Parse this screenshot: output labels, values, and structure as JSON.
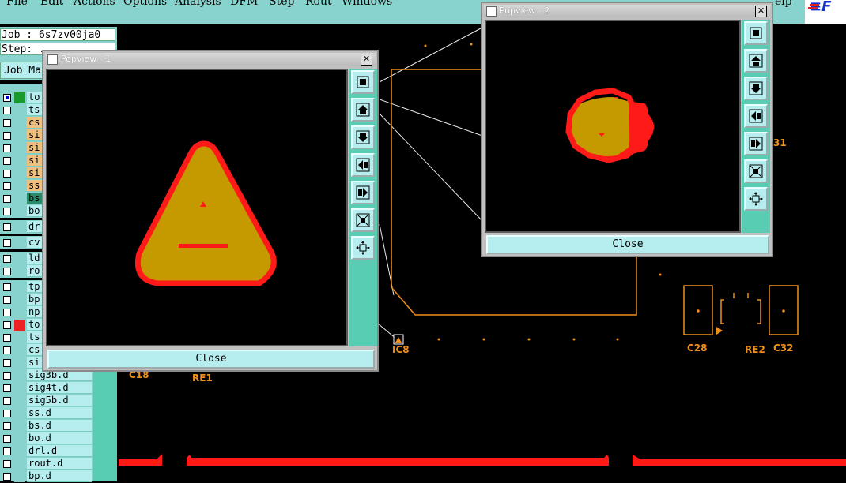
{
  "menu": [
    "File",
    "Edit",
    "Actions",
    "Options",
    "Analysis",
    "DFM",
    "Step",
    "Rout",
    "Windows",
    "elp"
  ],
  "job": {
    "label": "Job : 6s7zv00ja0",
    "step": "Step: ...",
    "job_matrix": "Job Ma"
  },
  "layers": [
    {
      "name": "to",
      "color": "#1a9a2a",
      "check_color": "#0000cc"
    },
    {
      "name": "ts",
      "color": "#89d3cf"
    },
    {
      "name": "cs",
      "color": "#89d3cf",
      "name_bg": "#f0c080"
    },
    {
      "name": "si",
      "color": "#89d3cf",
      "name_bg": "#f0c080"
    },
    {
      "name": "si",
      "color": "#89d3cf",
      "name_bg": "#f0c080"
    },
    {
      "name": "si",
      "color": "#89d3cf",
      "name_bg": "#f0c080"
    },
    {
      "name": "si",
      "color": "#89d3cf",
      "name_bg": "#f0c080"
    },
    {
      "name": "ss",
      "color": "#89d3cf",
      "name_bg": "#f0c080"
    },
    {
      "name": "bs",
      "color": "#89d3cf",
      "name_bg": "#2a8a6a"
    },
    {
      "name": "bo",
      "color": "#89d3cf"
    },
    {
      "name": "dr",
      "color": "#89d3cf"
    },
    {
      "name": "cv",
      "color": "#89d3cf"
    },
    {
      "name": "ld",
      "color": "#89d3cf"
    },
    {
      "name": "ro",
      "color": "#89d3cf"
    },
    {
      "name": "tp",
      "color": "#89d3cf"
    },
    {
      "name": "bp",
      "color": "#89d3cf"
    },
    {
      "name": "np",
      "color": "#89d3cf"
    },
    {
      "name": "to",
      "color": "#ee2222"
    },
    {
      "name": "ts",
      "color": "#89d3cf"
    },
    {
      "name": "cs",
      "color": "#89d3cf"
    },
    {
      "name": "si",
      "color": "#89d3cf"
    },
    {
      "name": "sig3b.d",
      "color": "#89d3cf"
    },
    {
      "name": "sig4t.d",
      "color": "#89d3cf"
    },
    {
      "name": "sig5b.d",
      "color": "#89d3cf"
    },
    {
      "name": "ss.d",
      "color": "#89d3cf"
    },
    {
      "name": "bs.d",
      "color": "#89d3cf"
    },
    {
      "name": "bo.d",
      "color": "#89d3cf"
    },
    {
      "name": "drl.d",
      "color": "#89d3cf"
    },
    {
      "name": "rout.d",
      "color": "#89d3cf"
    },
    {
      "name": "bp.d",
      "color": "#89d3cf"
    }
  ],
  "popup1": {
    "title": "Popview - 1",
    "close_label": "Close"
  },
  "popup2": {
    "title": "Popview - 2",
    "close_label": "Close"
  },
  "components": [
    "IC8",
    "C18",
    "RE1",
    "C28",
    "RE2",
    "C32",
    "31"
  ],
  "colors": {
    "pad_fill": "#c49a00",
    "pad_outline": "#ff1a1a",
    "panel": "#89d3cf",
    "trace": "#f0901a"
  }
}
